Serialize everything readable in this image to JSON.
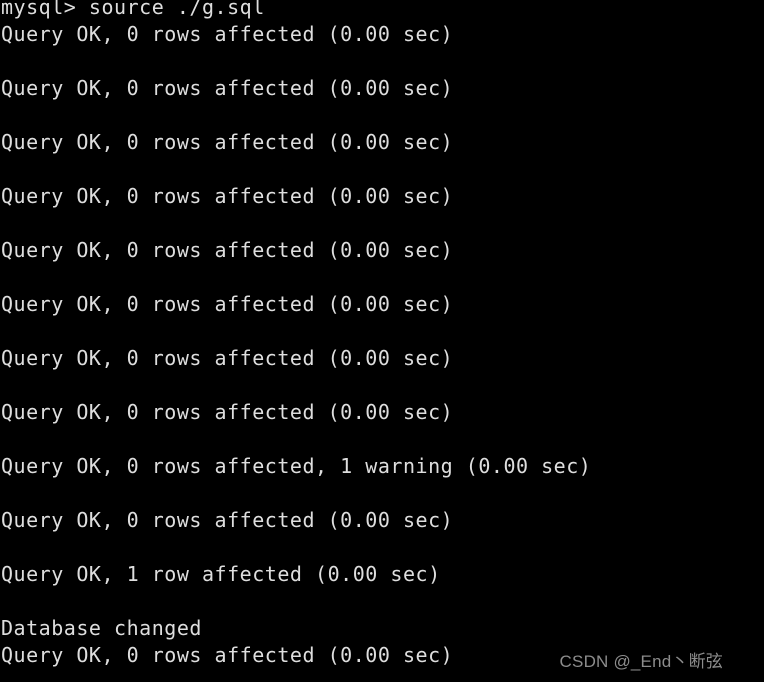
{
  "terminal": {
    "background_color": "#000000",
    "foreground_color": "#dedede",
    "prompt": "mysql>",
    "command": "source ./g.sql",
    "lines": [
      {
        "text": "mysql> source ./g.sql",
        "kind": "prompt"
      },
      {
        "text": "Query OK, 0 rows affected (0.00 sec)",
        "kind": "result"
      },
      {
        "text": "",
        "kind": "blank"
      },
      {
        "text": "Query OK, 0 rows affected (0.00 sec)",
        "kind": "result"
      },
      {
        "text": "",
        "kind": "blank"
      },
      {
        "text": "Query OK, 0 rows affected (0.00 sec)",
        "kind": "result"
      },
      {
        "text": "",
        "kind": "blank"
      },
      {
        "text": "Query OK, 0 rows affected (0.00 sec)",
        "kind": "result"
      },
      {
        "text": "",
        "kind": "blank"
      },
      {
        "text": "Query OK, 0 rows affected (0.00 sec)",
        "kind": "result"
      },
      {
        "text": "",
        "kind": "blank"
      },
      {
        "text": "Query OK, 0 rows affected (0.00 sec)",
        "kind": "result"
      },
      {
        "text": "",
        "kind": "blank"
      },
      {
        "text": "Query OK, 0 rows affected (0.00 sec)",
        "kind": "result"
      },
      {
        "text": "",
        "kind": "blank"
      },
      {
        "text": "Query OK, 0 rows affected (0.00 sec)",
        "kind": "result"
      },
      {
        "text": "",
        "kind": "blank"
      },
      {
        "text": "Query OK, 0 rows affected, 1 warning (0.00 sec)",
        "kind": "result"
      },
      {
        "text": "",
        "kind": "blank"
      },
      {
        "text": "Query OK, 0 rows affected (0.00 sec)",
        "kind": "result"
      },
      {
        "text": "",
        "kind": "blank"
      },
      {
        "text": "Query OK, 1 row affected (0.00 sec)",
        "kind": "result"
      },
      {
        "text": "",
        "kind": "blank"
      },
      {
        "text": "Database changed",
        "kind": "status"
      },
      {
        "text": "Query OK, 0 rows affected (0.00 sec)",
        "kind": "result"
      }
    ]
  },
  "watermark": {
    "text": "CSDN @_End丶断弦",
    "color": "#8c8c8c"
  }
}
